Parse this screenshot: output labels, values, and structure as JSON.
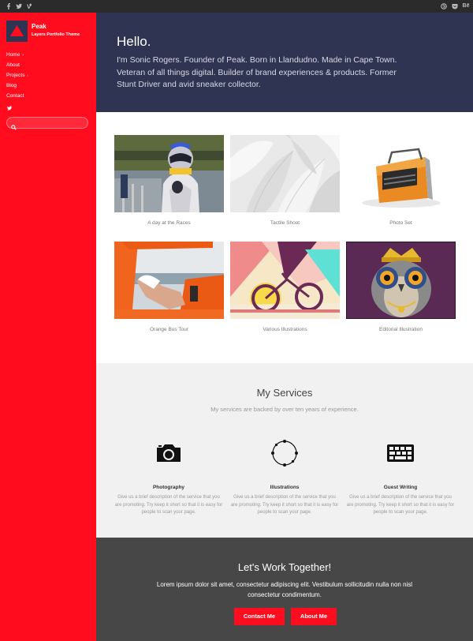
{
  "topbar": {
    "left_icons": [
      "facebook-icon",
      "twitter-icon",
      "vine-icon"
    ],
    "right_icons": [
      "dribbble-icon",
      "pocket-icon"
    ],
    "right_text": "Bē"
  },
  "sidebar": {
    "brand": "Peak",
    "tagline": "Layers Portfolio Theme",
    "nav": [
      {
        "label": "Home",
        "chevron": "›"
      },
      {
        "label": "About",
        "chevron": ""
      },
      {
        "label": "Projects",
        "chevron": "›"
      },
      {
        "label": "Blog",
        "chevron": ""
      },
      {
        "label": "Contact",
        "chevron": ""
      }
    ],
    "social_icon": "twitter-icon",
    "search_placeholder": ""
  },
  "hero": {
    "title": "Hello.",
    "text": "I'm Sonic Rogers. Founder of Peak. Born in Llandudno. Made in Cape Town. Veteran of all things digital. Builder of brand experiences & products. Former Stunt Driver and avid sneaker collector."
  },
  "projects": [
    {
      "caption": "A day at the Races"
    },
    {
      "caption": "Tactile Shoot"
    },
    {
      "caption": "Photo Set"
    },
    {
      "caption": "Orange Bus Tour"
    },
    {
      "caption": "Various Illustrations"
    },
    {
      "caption": "Editorial Illustration"
    }
  ],
  "services": {
    "title": "My Services",
    "subtitle": "My services are backed by over ten years of experience.",
    "items": [
      {
        "name": "Photography",
        "icon": "camera-icon",
        "desc": "Give us a brief description of the service that you are promoting. Try keep it short so that it is easy for people to scan your page."
      },
      {
        "name": "Illustrations",
        "icon": "circle-nodes-icon",
        "desc": "Give us a brief description of the service that you are promoting. Try keep it short so that it is easy for people to scan your page."
      },
      {
        "name": "Guest Writing",
        "icon": "keyboard-icon",
        "desc": "Give us a brief description of the service that you are promoting. Try keep it short so that it is easy for people to scan your page."
      }
    ]
  },
  "cta": {
    "title": "Let's Work Together!",
    "text": "Lorem ipsum dolor sit amet, consectetur adipiscing elit. Vestibulum sollicitudin nulla non nisl consectetur condimentum.",
    "buttons": [
      "Contact Me",
      "About Me"
    ]
  },
  "colors": {
    "accent": "#ff0d1e",
    "hero_bg": "#2f3452",
    "topbar_bg": "#2b2b2b",
    "services_bg": "#f1f1f1",
    "cta_bg": "#474747"
  }
}
